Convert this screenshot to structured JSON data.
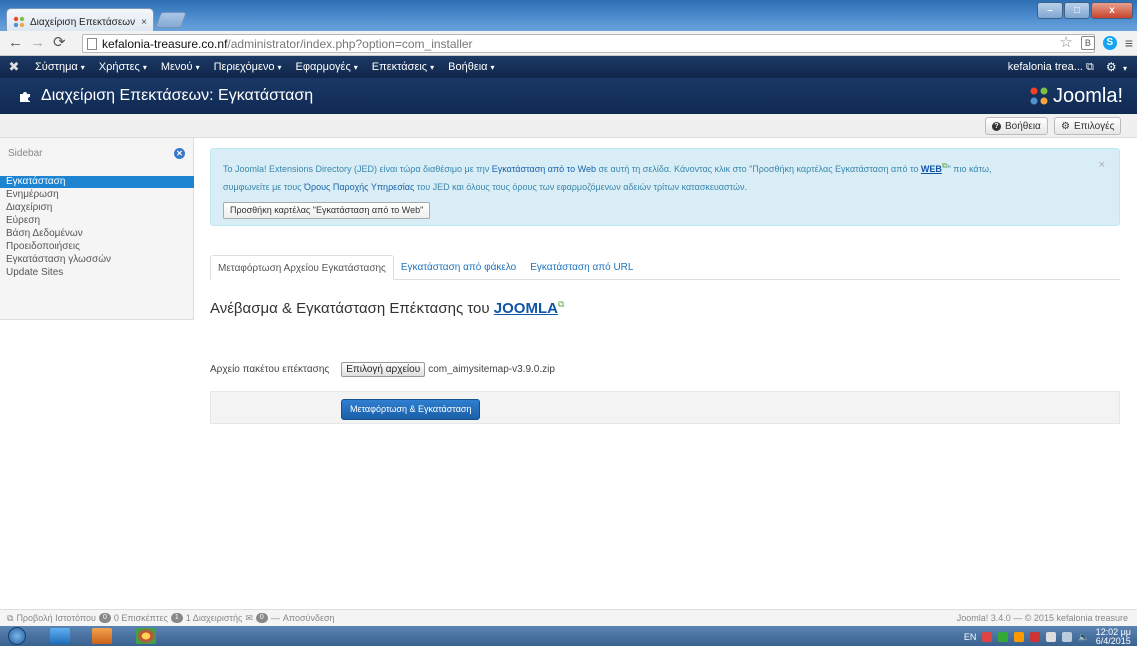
{
  "browser": {
    "tab_title": "Διαχείριση Επεκτάσεων ·",
    "tab_close": "×",
    "url_host": "kefalonia-treasure.co.nf",
    "url_path": "/administrator/index.php?option=com_installer",
    "window_buttons": {
      "min": "–",
      "max": "□",
      "close": "x"
    }
  },
  "topnav": {
    "items": [
      {
        "label": "Σύστημα"
      },
      {
        "label": "Χρήστες"
      },
      {
        "label": "Μενού"
      },
      {
        "label": "Περιεχόμενο"
      },
      {
        "label": "Εφαρμογές"
      },
      {
        "label": "Επεκτάσεις"
      },
      {
        "label": "Βοήθεια"
      }
    ],
    "site_link": "kefalonia trea...",
    "user_menu_icon": "gear-icon"
  },
  "header": {
    "title": "Διαχείριση Επεκτάσεων: Εγκατάσταση",
    "brand": "Joomla!"
  },
  "toolbar": {
    "help_label": "Βοήθεια",
    "options_label": "Επιλογές"
  },
  "sidebar": {
    "heading": "Sidebar",
    "items": [
      {
        "label": "Εγκατάσταση",
        "active": true
      },
      {
        "label": "Ενημέρωση"
      },
      {
        "label": "Διαχείριση"
      },
      {
        "label": "Εύρεση"
      },
      {
        "label": "Βάση Δεδομένων"
      },
      {
        "label": "Προειδοποιήσεις"
      },
      {
        "label": "Εγκατάσταση γλωσσών"
      },
      {
        "label": "Update Sites"
      }
    ]
  },
  "alert": {
    "line1_a": "To Joomla! Extensions Directory (JED) είναι τώρα διαθέσιμο με την ",
    "line1_link": "Εγκατάσταση από το Web",
    "line1_b": " σε αυτή τη σελίδα.  Κάνοντας κλικ στο \"Προσθήκη καρτέλας Εγκατάσταση από το ",
    "line1_web": "WEB",
    "line1_c": "\" πιο κάτω,",
    "line2_a": "συμφωνείτε με τους ",
    "line2_link": "Όρους Παροχής Υπηρεσίας",
    "line2_b": " του JED και όλους τους όρους των εφαρμοζόμενων αδειών τρίτων κατασκευαστών.",
    "button": "Προσθήκη καρτέλας \"Εγκατάσταση από το Web\"",
    "close": "×"
  },
  "tabs": [
    {
      "label": "Μεταφόρτωση Αρχείου Εγκατάστασης",
      "active": true
    },
    {
      "label": "Εγκατάσταση από φάκελο"
    },
    {
      "label": "Εγκατάσταση από URL"
    }
  ],
  "upload": {
    "title_prefix": "Ανέβασμα & Εγκατάσταση Επέκτασης του ",
    "title_link": "JOOMLA",
    "file_label": "Αρχείο πακέτου επέκτασης",
    "choose_button": "Επιλογή αρχείου",
    "file_name": "com_aimysitemap-v3.9.0.zip",
    "submit_button": "Μεταφόρτωση & Εγκατάσταση"
  },
  "statusbar": {
    "preview": "Προβολή Ιστοτόπου",
    "visitors_count": "0",
    "visitors_label": "0 Επισκέπτες",
    "admins_count": "1",
    "admins_label": "1 Διαχειριστής",
    "messages_count": "0",
    "logout": "Αποσύνδεση",
    "dash": "—",
    "footer": "Joomla! 3.4.0 — © 2015 kefalonia treasure"
  },
  "taskbar": {
    "lang": "EN",
    "time": "12:02 μμ",
    "date": "6/4/2015"
  },
  "colors": {
    "joomla_navy": "#10264a",
    "accent_blue": "#1c84d0",
    "alert_bg": "#d9edf7"
  }
}
